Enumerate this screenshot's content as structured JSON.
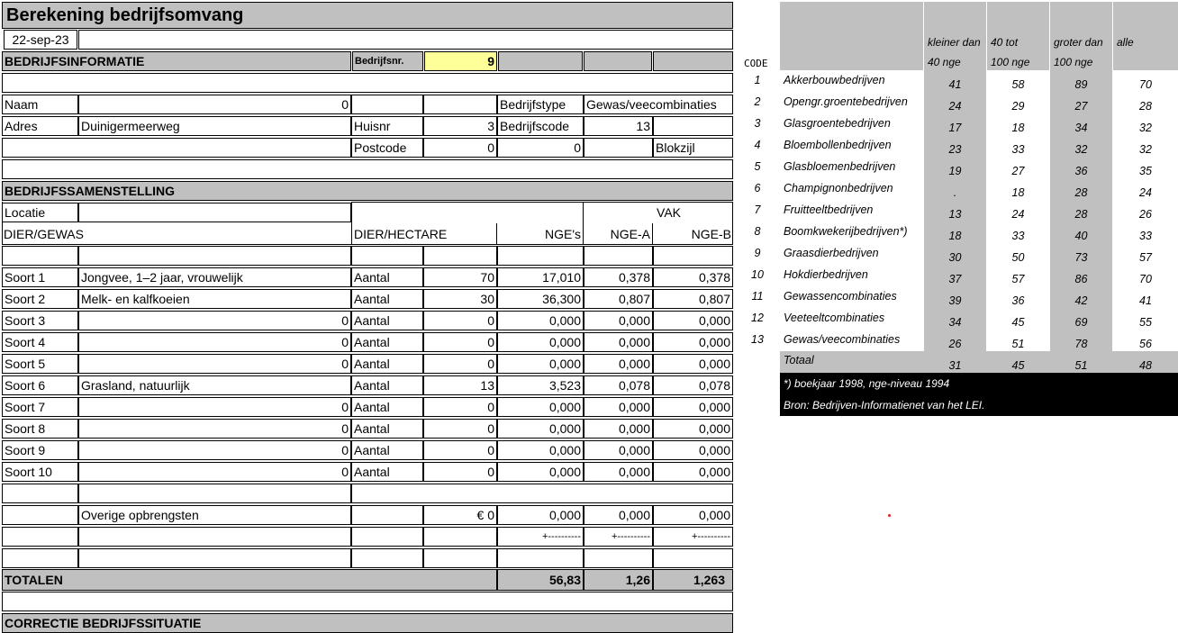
{
  "title": "Berekening bedrijfsomvang",
  "date": "22-sep-23",
  "info": {
    "header": "BEDRIJFSINFORMATIE",
    "nr_label": "Bedrijfsnr.",
    "nr_value": "9",
    "naam_label": "Naam",
    "naam_value": "0",
    "type_label": "Bedrijfstype",
    "type_value": "Gewas/veecombinaties",
    "adres_label": "Adres",
    "adres_value": "Duinigermeerweg",
    "huisnr_label": "Huisnr",
    "huisnr_value": "3",
    "code_label": "Bedrijfscode",
    "code_value": "13",
    "postcode_label": "Postcode",
    "postcode_value": "0",
    "postcode_value2": "0",
    "plaats": "Blokzijl"
  },
  "composition": {
    "header": "BEDRIJFSSAMENSTELLING",
    "locatie_label": "Locatie",
    "vak_label": "VAK",
    "col_dier_gewas": "DIER/GEWAS",
    "col_dier_hectare": "DIER/HECTARE",
    "col_nge": "NGE's",
    "col_nge_a": "NGE-A",
    "col_nge_b": "NGE-B",
    "rows": [
      {
        "label": "Soort 1",
        "name": "Jongvee, 1–2 jaar, vrouwelijk",
        "unit": "Aantal",
        "qty": "70",
        "nge": "17,010",
        "a": "0,378",
        "b": "0,378"
      },
      {
        "label": "Soort 2",
        "name": "Melk- en kalfkoeien",
        "unit": "Aantal",
        "qty": "30",
        "nge": "36,300",
        "a": "0,807",
        "b": "0,807"
      },
      {
        "label": "Soort 3",
        "name": "0",
        "unit": "Aantal",
        "qty": "0",
        "nge": "0,000",
        "a": "0,000",
        "b": "0,000"
      },
      {
        "label": "Soort 4",
        "name": "0",
        "unit": "Aantal",
        "qty": "0",
        "nge": "0,000",
        "a": "0,000",
        "b": "0,000"
      },
      {
        "label": "Soort 5",
        "name": "0",
        "unit": "Aantal",
        "qty": "0",
        "nge": "0,000",
        "a": "0,000",
        "b": "0,000"
      },
      {
        "label": "Soort 6",
        "name": "Grasland, natuurlijk",
        "unit": "Aantal",
        "qty": "13",
        "nge": "3,523",
        "a": "0,078",
        "b": "0,078"
      },
      {
        "label": "Soort 7",
        "name": "0",
        "unit": "Aantal",
        "qty": "0",
        "nge": "0,000",
        "a": "0,000",
        "b": "0,000"
      },
      {
        "label": "Soort 8",
        "name": "0",
        "unit": "Aantal",
        "qty": "0",
        "nge": "0,000",
        "a": "0,000",
        "b": "0,000"
      },
      {
        "label": "Soort 9",
        "name": "0",
        "unit": "Aantal",
        "qty": "0",
        "nge": "0,000",
        "a": "0,000",
        "b": "0,000"
      },
      {
        "label": "Soort 10",
        "name": "0",
        "unit": "Aantal",
        "qty": "0",
        "nge": "0,000",
        "a": "0,000",
        "b": "0,000"
      }
    ],
    "overige_label": "Overige opbrengsten",
    "overige_value": "€ 0",
    "overige_nge": "0,000",
    "overige_a": "0,000",
    "overige_b": "0,000",
    "sum_line": "+----------"
  },
  "totals": {
    "label": "TOTALEN",
    "nge": "56,83",
    "a": "1,26",
    "b": "1,263"
  },
  "correction_header": "CORRECTIE BEDRIJFSSITUATIE",
  "ref": {
    "code_header": "CODE",
    "col_headers_line1": [
      "kleiner dan",
      "40 tot",
      "groter dan",
      "alle"
    ],
    "col_headers_line2": [
      "40 nge",
      "100 nge",
      "100 nge",
      ""
    ],
    "rows": [
      {
        "code": "1",
        "name": "Akkerbouwbedrijven",
        "v": [
          "41",
          "58",
          "89",
          "70"
        ]
      },
      {
        "code": "2",
        "name": "Opengr.groentebedrijven",
        "v": [
          "24",
          "29",
          "27",
          "28"
        ]
      },
      {
        "code": "3",
        "name": "Glasgroentebedrijven",
        "v": [
          "17",
          "18",
          "34",
          "32"
        ]
      },
      {
        "code": "4",
        "name": "Bloembollenbedrijven",
        "v": [
          "23",
          "33",
          "32",
          "32"
        ]
      },
      {
        "code": "5",
        "name": "Glasbloemenbedrijven",
        "v": [
          "19",
          "27",
          "36",
          "35"
        ]
      },
      {
        "code": "6",
        "name": "Champignonbedrijven",
        "v": [
          ".",
          "18",
          "28",
          "24"
        ]
      },
      {
        "code": "7",
        "name": "Fruitteeltbedrijven",
        "v": [
          "13",
          "24",
          "28",
          "26"
        ]
      },
      {
        "code": "8",
        "name": "Boomkwekerijbedrijven*)",
        "v": [
          "18",
          "33",
          "40",
          "33"
        ]
      },
      {
        "code": "9",
        "name": "Graasdierbedrijven",
        "v": [
          "30",
          "50",
          "73",
          "57"
        ]
      },
      {
        "code": "10",
        "name": "Hokdierbedrijven",
        "v": [
          "37",
          "57",
          "86",
          "70"
        ]
      },
      {
        "code": "11",
        "name": "Gewassencombinaties",
        "v": [
          "39",
          "36",
          "42",
          "41"
        ]
      },
      {
        "code": "12",
        "name": "Veeteeltcombinaties",
        "v": [
          "34",
          "45",
          "69",
          "55"
        ]
      },
      {
        "code": "13",
        "name": "Gewas/veecombinaties",
        "v": [
          "26",
          "51",
          "78",
          "56"
        ]
      }
    ],
    "total_label": "Totaal",
    "total_values": [
      "31",
      "45",
      "51",
      "48"
    ],
    "footnote": "*) boekjaar 1998, nge-niveau 1994",
    "source": "Bron: Bedrijven-Informatienet van het LEI."
  }
}
